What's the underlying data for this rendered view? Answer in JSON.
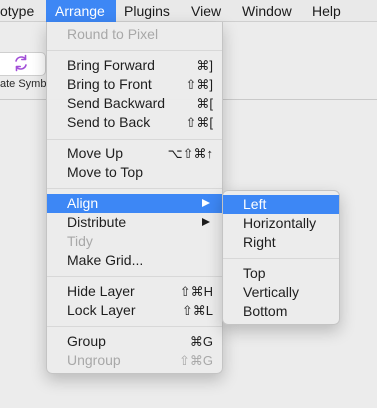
{
  "menubar": {
    "items": [
      "otype",
      "Arrange",
      "Plugins",
      "View",
      "Window",
      "Help"
    ],
    "active_color": "#3d87f5"
  },
  "toolbar": {
    "symbol_button_icon": "refresh-symbol-icon",
    "symbol_button_label": "ate Symb",
    "icon_color": "#a24fd8"
  },
  "arrange_menu": {
    "items": [
      {
        "label": "Round to Pixel",
        "shortcut": "",
        "enabled": false
      },
      {
        "label": "Bring Forward",
        "shortcut": "⌘]",
        "enabled": true
      },
      {
        "label": "Bring to Front",
        "shortcut": "⇧⌘]",
        "enabled": true
      },
      {
        "label": "Send Backward",
        "shortcut": "⌘[",
        "enabled": true
      },
      {
        "label": "Send to Back",
        "shortcut": "⇧⌘[",
        "enabled": true
      },
      {
        "label": "Move Up",
        "shortcut": "⌥⇧⌘↑",
        "enabled": true
      },
      {
        "label": "Move to Top",
        "shortcut": "",
        "enabled": true
      },
      {
        "label": "Align",
        "shortcut": "",
        "enabled": true,
        "submenu": true,
        "highlighted": true
      },
      {
        "label": "Distribute",
        "shortcut": "",
        "enabled": true,
        "submenu": true
      },
      {
        "label": "Tidy",
        "shortcut": "",
        "enabled": false
      },
      {
        "label": "Make Grid...",
        "shortcut": "",
        "enabled": true
      },
      {
        "label": "Hide Layer",
        "shortcut": "⇧⌘H",
        "enabled": true
      },
      {
        "label": "Lock Layer",
        "shortcut": "⇧⌘L",
        "enabled": true
      },
      {
        "label": "Group",
        "shortcut": "⌘G",
        "enabled": true
      },
      {
        "label": "Ungroup",
        "shortcut": "⇧⌘G",
        "enabled": false
      }
    ]
  },
  "align_submenu": {
    "items": [
      {
        "label": "Left",
        "highlighted": true
      },
      {
        "label": "Horizontally"
      },
      {
        "label": "Right"
      },
      {
        "label": "Top"
      },
      {
        "label": "Vertically"
      },
      {
        "label": "Bottom"
      }
    ]
  }
}
